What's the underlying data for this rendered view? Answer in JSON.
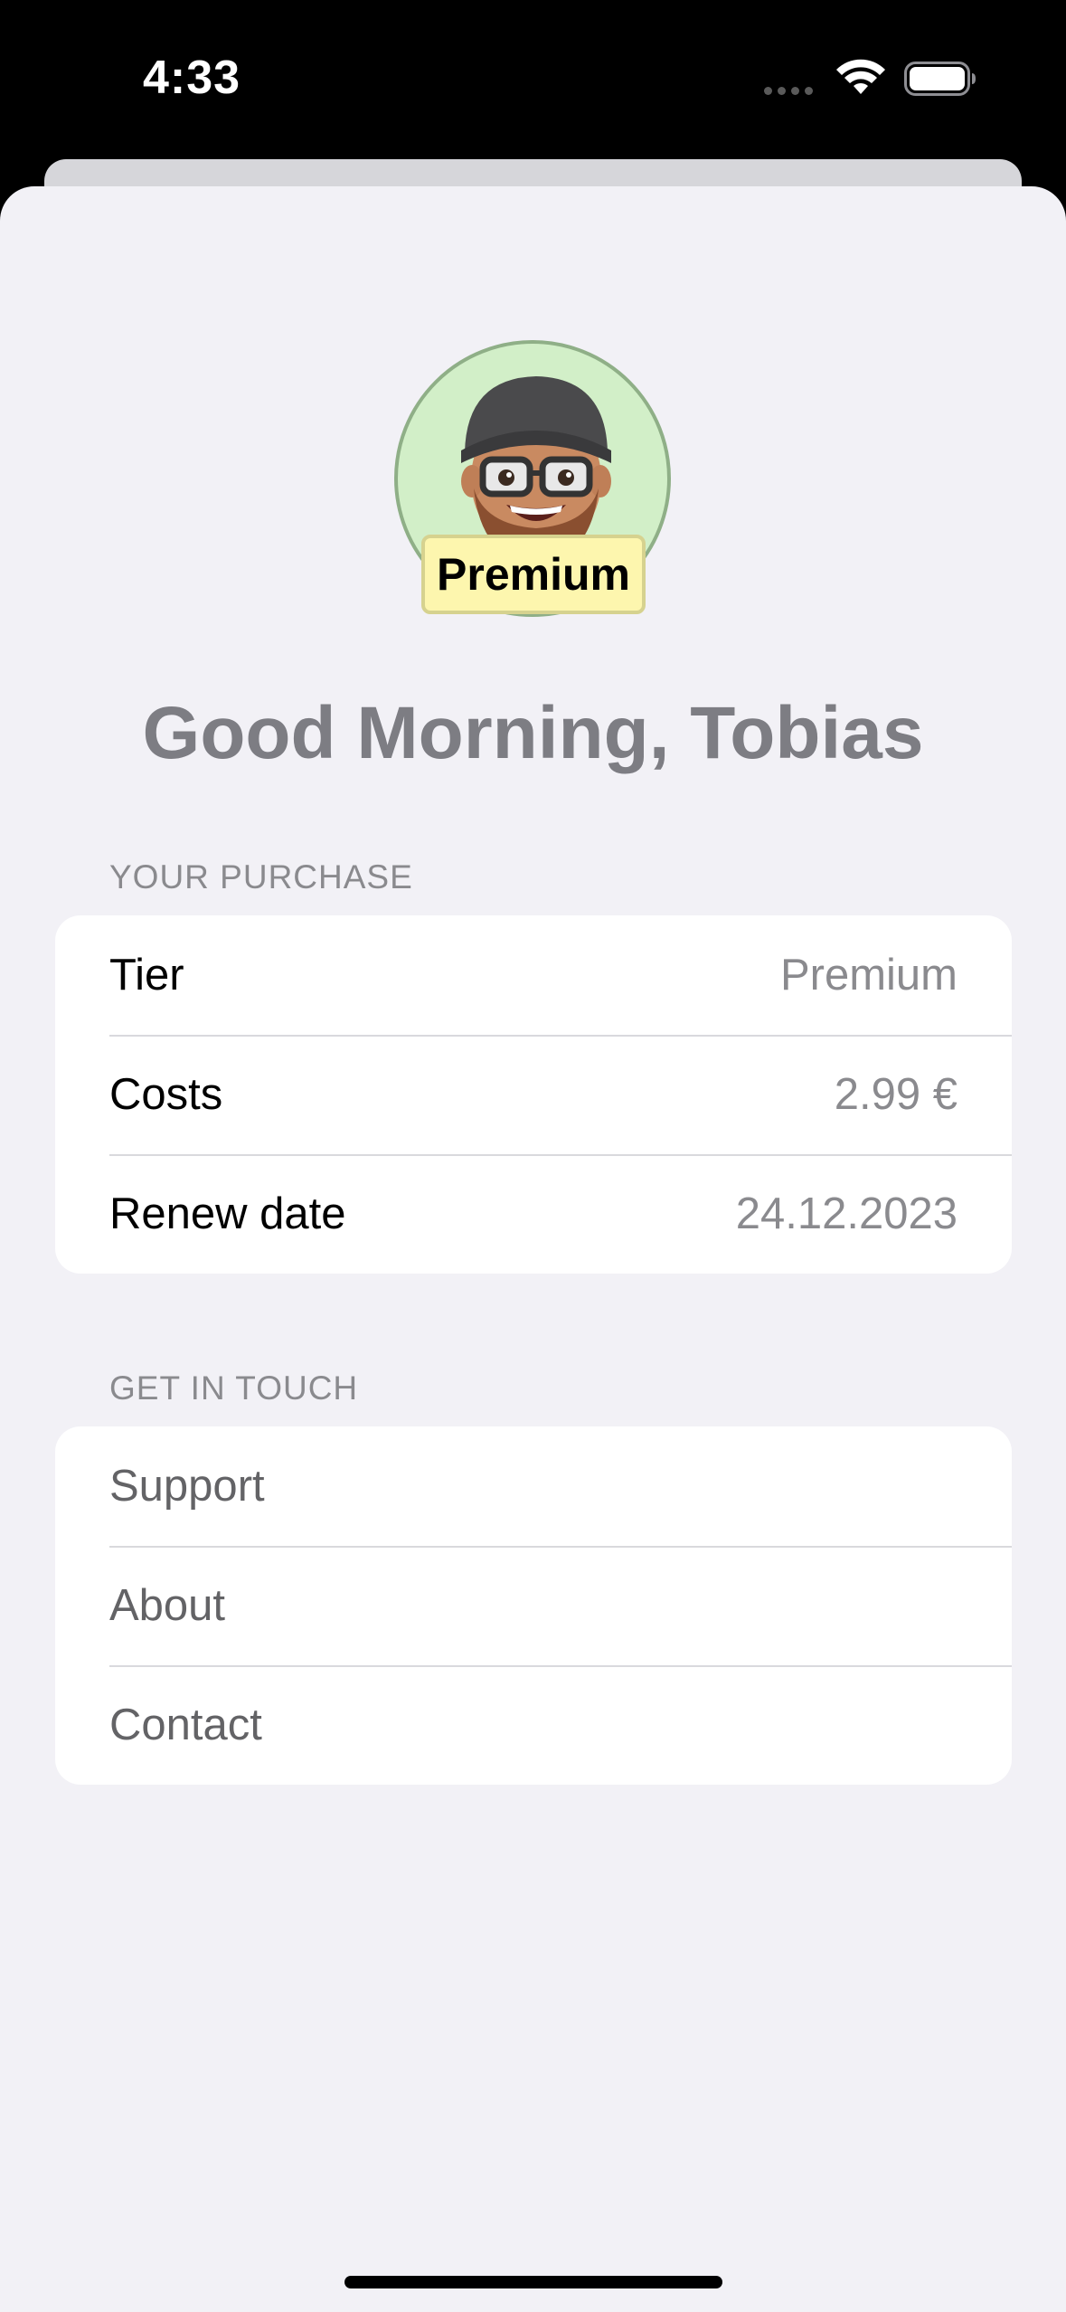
{
  "status_bar": {
    "time": "4:33"
  },
  "profile": {
    "badge_label": "Premium",
    "greeting": "Good Morning, Tobias"
  },
  "purchase_section": {
    "header": "YOUR PURCHASE",
    "rows": [
      {
        "label": "Tier",
        "value": "Premium"
      },
      {
        "label": "Costs",
        "value": "2.99 €"
      },
      {
        "label": "Renew date",
        "value": "24.12.2023"
      }
    ]
  },
  "contact_section": {
    "header": "GET IN TOUCH",
    "links": [
      {
        "label": "Support"
      },
      {
        "label": "About"
      },
      {
        "label": "Contact"
      }
    ]
  },
  "colors": {
    "sheet_background": "#f2f1f6",
    "avatar_background": "#d2efc8",
    "badge_background": "#fdf6ae",
    "secondary_text": "#8a8a8e"
  }
}
